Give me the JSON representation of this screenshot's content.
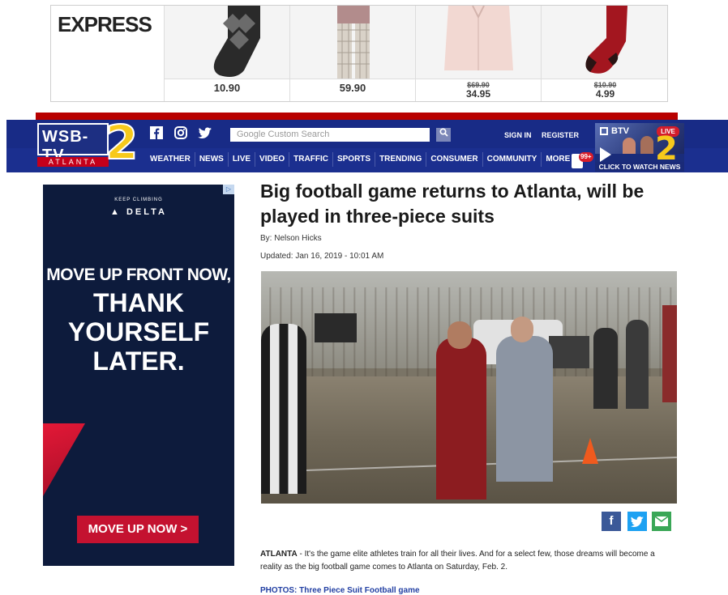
{
  "top_ad": {
    "brand": "EXPRESS",
    "items": [
      {
        "price": "10.90",
        "old_price": ""
      },
      {
        "price": "59.90",
        "old_price": ""
      },
      {
        "price": "34.95",
        "old_price": "$69.90"
      },
      {
        "price": "4.99",
        "old_price": "$10.90"
      }
    ]
  },
  "header": {
    "logo_text": "WSB-TV",
    "logo_number": "2",
    "logo_city": "ATLANTA",
    "search_placeholder": "Google Custom Search",
    "sign_in": "SIGN IN",
    "register": "REGISTER",
    "nav": [
      "WEATHER",
      "NEWS",
      "LIVE",
      "VIDEO",
      "TRAFFIC",
      "SPORTS",
      "TRENDING",
      "CONSUMER",
      "COMMUNITY",
      "MORE"
    ],
    "notification_count": "99+",
    "live_promo": {
      "channel": "BTV",
      "live": "LIVE",
      "cta": "CLICK TO WATCH NEWS"
    }
  },
  "side_ad": {
    "tagline": "KEEP CLIMBING",
    "brand": "DELTA",
    "line1": "MOVE UP FRONT NOW,",
    "line2": "THANK",
    "line3": "YOURSELF",
    "line4": "LATER.",
    "cta": "MOVE UP NOW >"
  },
  "article": {
    "headline": "Big football game returns to Atlanta, will be played in three-piece suits",
    "byline": "By: Nelson Hicks",
    "updated": "Updated: Jan 16, 2019 - 10:01 AM",
    "dateline": "ATLANTA",
    "body": " - It's the game elite athletes train for all their lives. And for a select few, those dreams will become a reality as the big football game comes to Atlanta on Saturday, Feb. 2.",
    "photos_link": "PHOTOS: Three Piece Suit Football game"
  },
  "share": {
    "facebook_color": "#3b5998",
    "twitter_color": "#1da1f2",
    "email_color": "#3aa757"
  }
}
